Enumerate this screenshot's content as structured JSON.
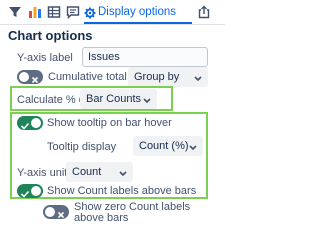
{
  "toolbar": {
    "tabs": [
      {
        "name": "filter",
        "icon": "filter-icon"
      },
      {
        "name": "chart-type",
        "icon": "bar-chart-icon"
      },
      {
        "name": "table",
        "icon": "table-icon"
      },
      {
        "name": "comment",
        "icon": "comment-icon"
      },
      {
        "name": "display-options",
        "icon": "gear-icon",
        "label": "Display options",
        "active": true
      },
      {
        "name": "export",
        "icon": "upload-icon"
      }
    ]
  },
  "panel": {
    "title": "Chart options",
    "y_axis_label": {
      "label": "Y-axis label",
      "value": "Issues"
    },
    "cumulative": {
      "label": "Cumulative total of",
      "enabled": false,
      "group_by": "Group by"
    },
    "calculate": {
      "label": "Calculate % of",
      "value": "Bar Counts"
    },
    "tooltip": {
      "label": "Show tooltip on bar hover",
      "enabled": true
    },
    "tooltip_display": {
      "label": "Tooltip display",
      "value": "Count (%)"
    },
    "y_axis_unit": {
      "label": "Y-axis unit",
      "value": "Count"
    },
    "count_labels": {
      "label": "Show Count labels above bars",
      "enabled": true
    },
    "zero_labels": {
      "label": "Show zero Count labels above bars",
      "enabled": false
    }
  },
  "colors": {
    "accent": "#0c66e4",
    "highlight": "#7bd14f",
    "toggle_on": "#1f845a",
    "toggle_off": "#5e6c84"
  }
}
